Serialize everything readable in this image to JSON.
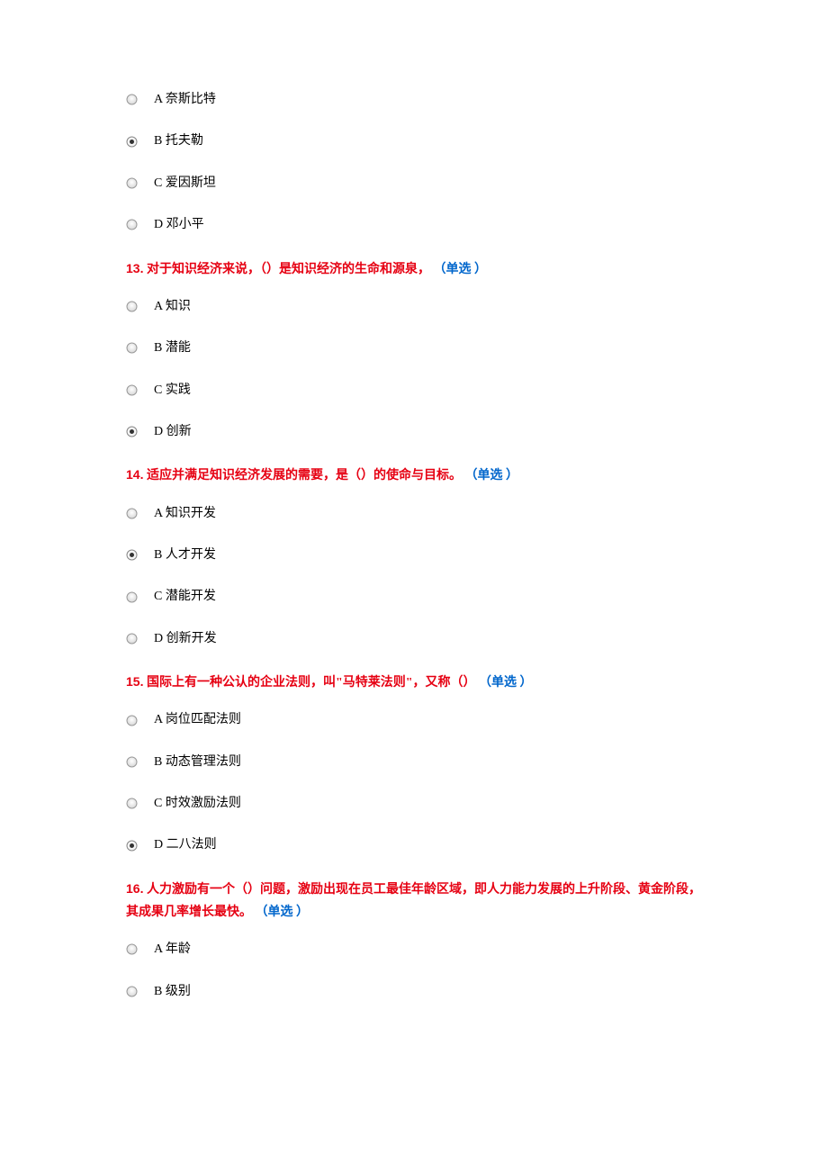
{
  "questions": [
    {
      "number": "",
      "text": "",
      "type": "",
      "options": [
        {
          "label": "A",
          "text": "奈斯比特",
          "selected": false
        },
        {
          "label": "B",
          "text": "托夫勒",
          "selected": true
        },
        {
          "label": "C",
          "text": "爱因斯坦",
          "selected": false
        },
        {
          "label": "D",
          "text": "邓小平",
          "selected": false
        }
      ]
    },
    {
      "number": "13.",
      "text": "对于知识经济来说，（）是知识经济的生命和源泉，",
      "type": "（单选 ）",
      "options": [
        {
          "label": "A",
          "text": "知识",
          "selected": false
        },
        {
          "label": "B",
          "text": "潜能",
          "selected": false
        },
        {
          "label": "C",
          "text": "实践",
          "selected": false
        },
        {
          "label": "D",
          "text": "创新",
          "selected": true
        }
      ]
    },
    {
      "number": "14.",
      "text": "适应并满足知识经济发展的需要，是（）的使命与目标。",
      "type": "（单选 ）",
      "options": [
        {
          "label": "A",
          "text": "知识开发",
          "selected": false
        },
        {
          "label": "B",
          "text": "人才开发",
          "selected": true
        },
        {
          "label": "C",
          "text": "潜能开发",
          "selected": false
        },
        {
          "label": "D",
          "text": "创新开发",
          "selected": false
        }
      ]
    },
    {
      "number": "15.",
      "text": "国际上有一种公认的企业法则，叫\"马特莱法则\"，又称（）",
      "type": "（单选 ）",
      "options": [
        {
          "label": "A",
          "text": "岗位匹配法则",
          "selected": false
        },
        {
          "label": "B",
          "text": "动态管理法则",
          "selected": false
        },
        {
          "label": "C",
          "text": "时效激励法则",
          "selected": false
        },
        {
          "label": "D",
          "text": "二八法则",
          "selected": true
        }
      ]
    },
    {
      "number": "16.",
      "text": "人力激励有一个（）问题，激励出现在员工最佳年龄区域，即人力能力发展的上升阶段、黄金阶段，其成果几率增长最快。",
      "type": "（单选 ）",
      "options": [
        {
          "label": "A",
          "text": "年龄",
          "selected": false
        },
        {
          "label": "B",
          "text": "级别",
          "selected": false
        }
      ]
    }
  ]
}
